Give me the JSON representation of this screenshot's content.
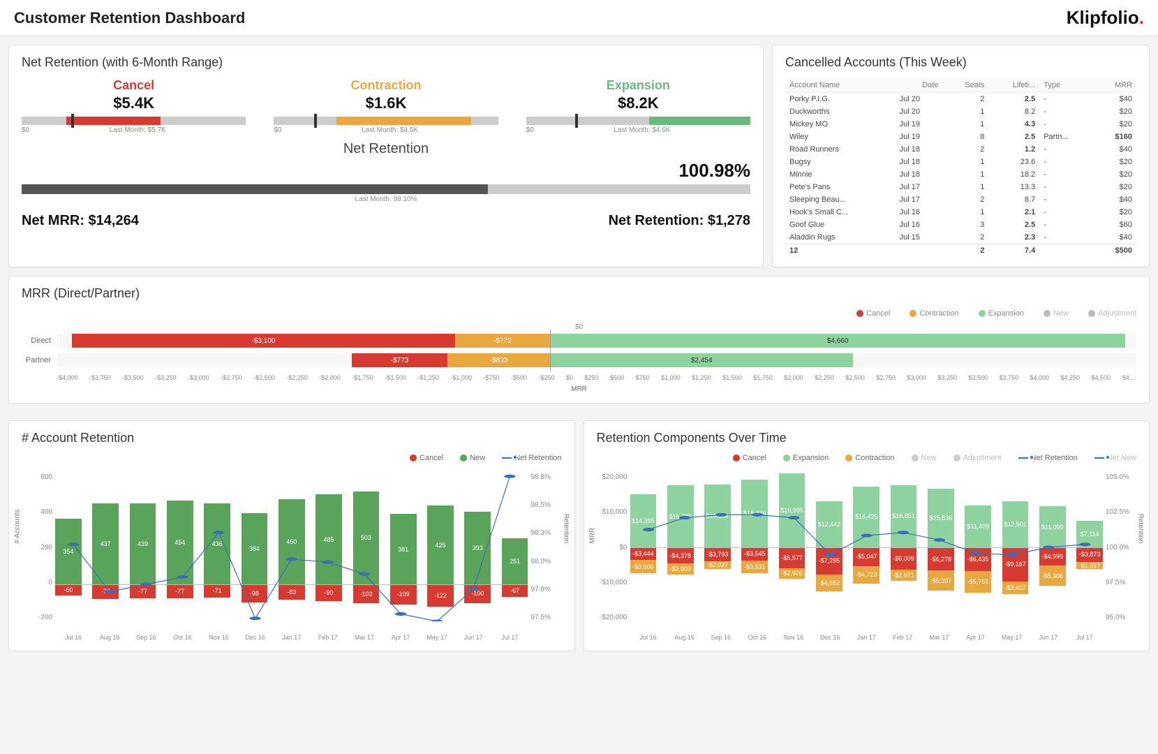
{
  "header": {
    "title": "Customer Retention Dashboard",
    "brand": "Klipfolio"
  },
  "net_retention": {
    "title": "Net Retention (with 6-Month Range)",
    "items": [
      {
        "label": "Cancel",
        "value": "$5.4K",
        "color": "#d63a31",
        "last": "Last Month: $5.7K",
        "fill_left": 20,
        "fill_width": 42,
        "marker": 22
      },
      {
        "label": "Contraction",
        "value": "$1.6K",
        "color": "#e9a83f",
        "last": "Last Month: $4.5K",
        "fill_left": 28,
        "fill_width": 60,
        "marker": 18
      },
      {
        "label": "Expansion",
        "value": "$8.2K",
        "color": "#6ab97e",
        "last": "Last Month: $4.6K",
        "fill_left": 55,
        "fill_width": 45,
        "marker": 22
      }
    ],
    "big_label": "Net Retention",
    "big_value": "100.98%",
    "big_fill_pct": 64,
    "big_last": "Last Month: 98.10%",
    "net_mrr_label": "Net MRR: $14,264",
    "net_ret_label": "Net Retention: $1,278"
  },
  "cancelled": {
    "title": "Cancelled Accounts (This Week)",
    "headers": [
      "Account Name",
      "Date",
      "Seats",
      "Lifeti...",
      "Type",
      "MRR"
    ],
    "rows": [
      {
        "name": "Porky P.I.G.",
        "date": "Jul 20",
        "seats": "2",
        "life": "2.5",
        "type": "-",
        "mrr": "$40",
        "neg": true
      },
      {
        "name": "Duckworths",
        "date": "Jul 20",
        "seats": "1",
        "life": "8.2",
        "type": "-",
        "mrr": "$20",
        "neg": false
      },
      {
        "name": "Mickey MO",
        "date": "Jul 19",
        "seats": "1",
        "life": "4.3",
        "type": "-",
        "mrr": "$20",
        "neg": true
      },
      {
        "name": "Wiley",
        "date": "Jul 19",
        "seats": "8",
        "life": "2.5",
        "type": "Partn...",
        "mrr": "$160",
        "neg": true,
        "mrr_neg": true
      },
      {
        "name": "Road Runners",
        "date": "Jul 18",
        "seats": "2",
        "life": "1.2",
        "type": "-",
        "mrr": "$40",
        "neg": true
      },
      {
        "name": "Bugsy",
        "date": "Jul 18",
        "seats": "1",
        "life": "23.6",
        "type": "-",
        "mrr": "$20",
        "neg": false
      },
      {
        "name": "Minnie",
        "date": "Jul 18",
        "seats": "1",
        "life": "18.2",
        "type": "-",
        "mrr": "$20",
        "neg": false
      },
      {
        "name": "Pete's Pans",
        "date": "Jul 17",
        "seats": "1",
        "life": "13.3",
        "type": "-",
        "mrr": "$20",
        "neg": false
      },
      {
        "name": "Sleeping Beau...",
        "date": "Jul 17",
        "seats": "2",
        "life": "8.7",
        "type": "-",
        "mrr": "$40",
        "neg": false
      },
      {
        "name": "Hook's Small C...",
        "date": "Jul 16",
        "seats": "1",
        "life": "2.1",
        "type": "-",
        "mrr": "$20",
        "neg": true
      },
      {
        "name": "Goof Glue",
        "date": "Jul 16",
        "seats": "3",
        "life": "2.5",
        "type": "-",
        "mrr": "$60",
        "neg": true
      },
      {
        "name": "Aladdin Rugs",
        "date": "Jul 15",
        "seats": "2",
        "life": "2.3",
        "type": "-",
        "mrr": "$40",
        "neg": true
      }
    ],
    "footer": {
      "count": "12",
      "seats": "2",
      "life": "7.4",
      "mrr": "$500"
    }
  },
  "mrr": {
    "title": "MRR (Direct/Partner)",
    "legend": [
      "Cancel",
      "Contraction",
      "Expansion",
      "New",
      "Adjustment"
    ],
    "colors": {
      "Cancel": "#d63a31",
      "Contraction": "#e9a83f",
      "Expansion": "#8ed29f",
      "New": "#bbb",
      "Adjustment": "#bbb"
    },
    "zero_top_label": "$0",
    "rows": [
      {
        "label": "Direct",
        "neg": [
          {
            "k": "Contraction",
            "v": -773
          },
          {
            "k": "Cancel",
            "v": -3100
          }
        ],
        "pos": [
          {
            "k": "Expansion",
            "v": 4660
          }
        ]
      },
      {
        "label": "Partner",
        "neg": [
          {
            "k": "Contraction",
            "v": -833
          },
          {
            "k": "Cancel",
            "v": -773
          }
        ],
        "pos": [
          {
            "k": "Expansion",
            "v": 2454
          }
        ]
      }
    ],
    "xlim": [
      -4000,
      4750
    ],
    "xticks": [
      "-$4,000",
      "-$3,750",
      "-$3,500",
      "-$3,250",
      "-$3,000",
      "-$2,750",
      "-$2,500",
      "-$2,250",
      "-$2,000",
      "-$1,750",
      "-$1,500",
      "-$1,250",
      "-$1,000",
      "-$750",
      "-$500",
      "-$250",
      "$0",
      "$250",
      "$500",
      "$750",
      "$1,000",
      "$1,250",
      "$1,500",
      "$1,750",
      "$2,000",
      "$2,250",
      "$2,500",
      "$2,750",
      "$3,000",
      "$3,250",
      "$3,500",
      "$3,750",
      "$4,000",
      "$4,250",
      "$4,500",
      "$4,..."
    ],
    "xtitle": "MRR"
  },
  "account_ret": {
    "title": "# Account Retention",
    "legend": [
      "Cancel",
      "New",
      "Net Retention"
    ],
    "months": [
      "Jul 16",
      "Aug 16",
      "Sep 16",
      "Oct 16",
      "Nov 16",
      "Dec 16",
      "Jan 17",
      "Feb 17",
      "Mar 17",
      "Apr 17",
      "May 17",
      "Jun 17",
      "Jul 17"
    ],
    "new": [
      354,
      437,
      439,
      454,
      436,
      384,
      460,
      485,
      503,
      381,
      425,
      393,
      251
    ],
    "cancel": [
      -60,
      -78,
      -77,
      -77,
      -71,
      -98,
      -83,
      -90,
      -103,
      -109,
      -122,
      -100,
      -67
    ],
    "ylim": [
      -200,
      600
    ],
    "yticks_l": [
      "600",
      "400",
      "200",
      "0",
      "-200"
    ],
    "yticks_r": [
      "98.8%",
      "98.5%",
      "98.3%",
      "98.0%",
      "97.8%",
      "97.5%"
    ],
    "ylabel_l": "# Accounts",
    "ylabel_r": "Retention",
    "line_rel": [
      0.52,
      0.2,
      0.25,
      0.3,
      0.6,
      0.02,
      0.42,
      0.4,
      0.32,
      0.05,
      0.0,
      0.22,
      0.98
    ]
  },
  "ret_components": {
    "title": "Retention Components Over Time",
    "legend": [
      "Cancel",
      "Expansion",
      "Contraction",
      "New",
      "Adjustment",
      "Net Retention",
      "Net New"
    ],
    "months": [
      "Jul 16",
      "Aug 16",
      "Sep 16",
      "Oct 16",
      "Nov 16",
      "Dec 16",
      "Jan 17",
      "Feb 17",
      "Mar 17",
      "Apr 17",
      "May 17",
      "Jun 17",
      "Jul 17"
    ],
    "expansion": [
      14395,
      16785,
      16994,
      18336,
      19995,
      12442,
      16425,
      16851,
      15836,
      11409,
      12501,
      11099,
      7114
    ],
    "cancel": [
      -3444,
      -4378,
      -3793,
      -3545,
      -5577,
      -7295,
      -5047,
      -6009,
      -6278,
      -6435,
      -9167,
      -4999,
      -3873
    ],
    "contraction": [
      -3600,
      -2903,
      -2027,
      -3531,
      -2926,
      -4652,
      -4723,
      -2971,
      -5397,
      -5751,
      -3437,
      -5306,
      -1927
    ],
    "ylim": [
      -20000,
      20000
    ],
    "yticks_l": [
      "$20,000",
      "$10,000",
      "$0",
      "-$10,000",
      "-$20,000"
    ],
    "yticks_r": [
      "105.0%",
      "102.5%",
      "100.0%",
      "97.5%",
      "95.0%"
    ],
    "ylabel_l": "MRR",
    "ylabel_r": "Retention",
    "line_rel": [
      0.62,
      0.7,
      0.72,
      0.72,
      0.7,
      0.45,
      0.58,
      0.6,
      0.55,
      0.46,
      0.45,
      0.5,
      0.52
    ]
  },
  "chart_data": [
    {
      "type": "bar",
      "orientation": "horizontal_stacked_diverging",
      "title": "MRR (Direct/Partner)",
      "categories": [
        "Direct",
        "Partner"
      ],
      "series": [
        {
          "name": "Contraction",
          "values": [
            -773,
            -833
          ]
        },
        {
          "name": "Cancel",
          "values": [
            -3100,
            -773
          ]
        },
        {
          "name": "Expansion",
          "values": [
            4660,
            2454
          ]
        }
      ],
      "xlabel": "MRR",
      "xlim": [
        -4000,
        4750
      ]
    },
    {
      "type": "bar",
      "title": "# Account Retention",
      "categories": [
        "Jul 16",
        "Aug 16",
        "Sep 16",
        "Oct 16",
        "Nov 16",
        "Dec 16",
        "Jan 17",
        "Feb 17",
        "Mar 17",
        "Apr 17",
        "May 17",
        "Jun 17",
        "Jul 17"
      ],
      "series": [
        {
          "name": "New",
          "values": [
            354,
            437,
            439,
            454,
            436,
            384,
            460,
            485,
            503,
            381,
            425,
            393,
            251
          ]
        },
        {
          "name": "Cancel",
          "values": [
            -60,
            -78,
            -77,
            -77,
            -71,
            -98,
            -83,
            -90,
            -103,
            -109,
            -122,
            -100,
            -67
          ]
        }
      ],
      "ylabel": "# Accounts",
      "ylim": [
        -200,
        600
      ],
      "secondary_axis": {
        "name": "Net Retention",
        "ylabel": "Retention",
        "ylim": [
          97.5,
          98.8
        ]
      }
    },
    {
      "type": "bar",
      "title": "Retention Components Over Time",
      "categories": [
        "Jul 16",
        "Aug 16",
        "Sep 16",
        "Oct 16",
        "Nov 16",
        "Dec 16",
        "Jan 17",
        "Feb 17",
        "Mar 17",
        "Apr 17",
        "May 17",
        "Jun 17",
        "Jul 17"
      ],
      "series": [
        {
          "name": "Expansion",
          "values": [
            14395,
            16785,
            16994,
            18336,
            19995,
            12442,
            16425,
            16851,
            15836,
            11409,
            12501,
            11099,
            7114
          ]
        },
        {
          "name": "Cancel",
          "values": [
            -3444,
            -4378,
            -3793,
            -3545,
            -5577,
            -7295,
            -5047,
            -6009,
            -6278,
            -6435,
            -9167,
            -4999,
            -3873
          ]
        },
        {
          "name": "Contraction",
          "values": [
            -3600,
            -2903,
            -2027,
            -3531,
            -2926,
            -4652,
            -4723,
            -2971,
            -5397,
            -5751,
            -3437,
            -5306,
            -1927
          ]
        }
      ],
      "ylabel": "MRR",
      "ylim": [
        -20000,
        20000
      ],
      "secondary_axis": {
        "name": "Net Retention",
        "ylabel": "Retention",
        "ylim": [
          95.0,
          105.0
        ]
      }
    }
  ]
}
